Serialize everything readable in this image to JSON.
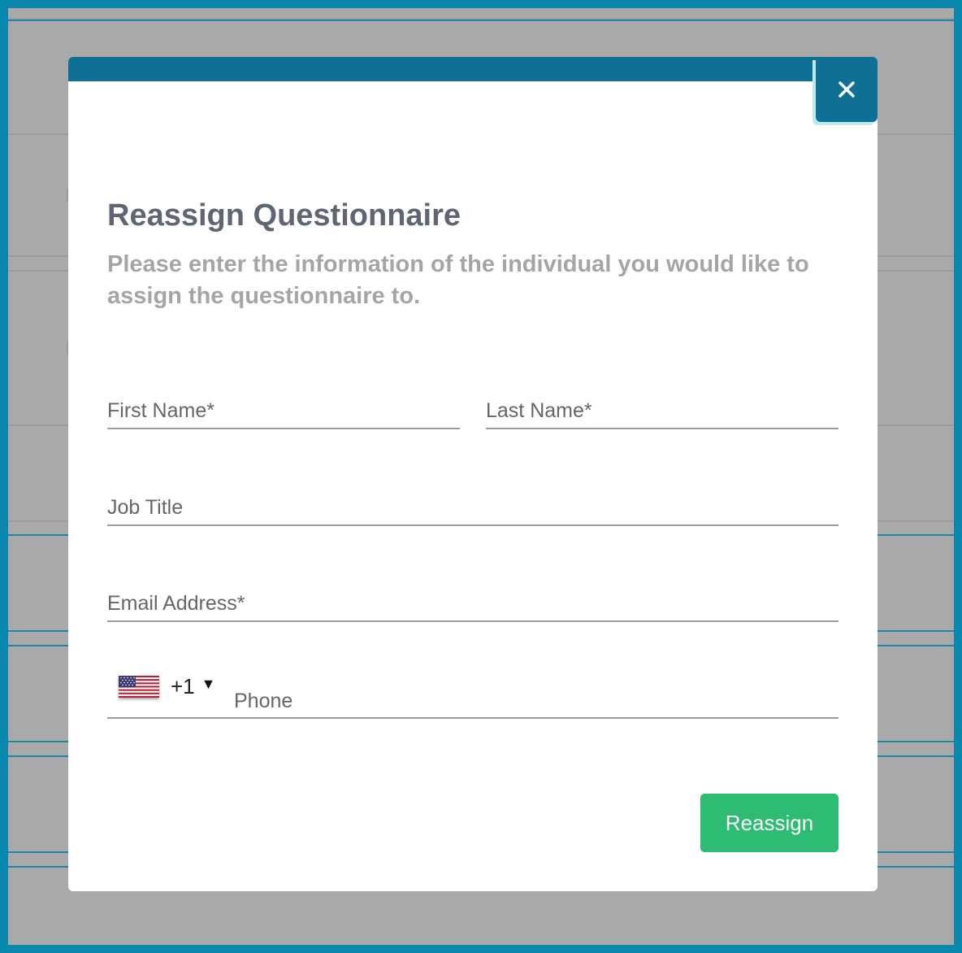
{
  "modal": {
    "title": "Reassign Questionnaire",
    "subtitle": "Please enter the information of the individual you would like to assign the questionnaire to.",
    "close_icon": "close-icon"
  },
  "form": {
    "first_name": {
      "placeholder": "First Name*",
      "value": ""
    },
    "last_name": {
      "placeholder": "Last Name*",
      "value": ""
    },
    "job_title": {
      "placeholder": "Job Title",
      "value": ""
    },
    "email": {
      "placeholder": "Email Address*",
      "value": ""
    },
    "phone": {
      "country_flag": "us-flag-icon",
      "dial_code": "+1",
      "caret": "▼",
      "placeholder": "Phone",
      "value": ""
    }
  },
  "actions": {
    "reassign_label": "Reassign"
  },
  "colors": {
    "header_bar": "#0f7096",
    "primary_button": "#2ebb74",
    "title_text": "#5d6672",
    "subtitle_text": "#a5a5a5",
    "overlay": "#a9a9a9",
    "frame_border": "#0b88ae"
  }
}
